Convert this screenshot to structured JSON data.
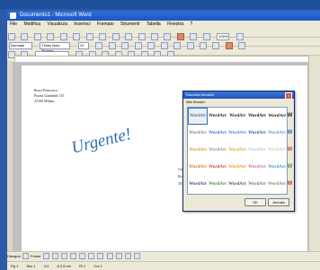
{
  "window": {
    "title": "Documento1 - Microsoft Word"
  },
  "menu": [
    "File",
    "Modifica",
    "Visualizza",
    "Inserisci",
    "Formato",
    "Strumenti",
    "Tabella",
    "Finestra",
    "?"
  ],
  "toolbar": {
    "font_name": "Times New Roman",
    "font_size": "12",
    "style": "Normale",
    "zoom": "100%"
  },
  "document": {
    "address": [
      "Rossi Francesca",
      "Piazza Garibaldi 135",
      "25100 Milano"
    ],
    "wordart_text": "Urgente!",
    "behind_text": [
      "Gen",
      "Ra",
      "201"
    ]
  },
  "dialog": {
    "title": "Raccolta WordArt",
    "section_label": "Stile WordArt:",
    "ok": "OK",
    "cancel": "Annulla",
    "sample": "WordArt",
    "side_sample": "W",
    "close_glyph": "×"
  },
  "drawbar": {
    "draw": "Disegna",
    "autoshapes": "Forme"
  },
  "status": {
    "page": "Pg 1",
    "section": "Sez 1",
    "pages": "1/1",
    "pos": "A 2,5 cm",
    "row": "Ri 1",
    "col": "Col 1"
  }
}
